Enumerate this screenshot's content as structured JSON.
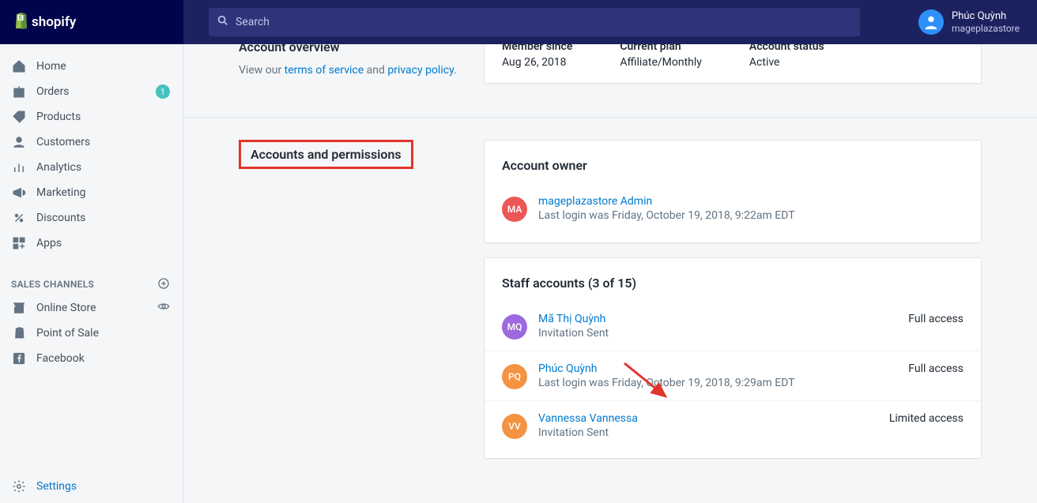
{
  "header": {
    "search_placeholder": "Search",
    "user_name": "Phúc Quỳnh",
    "user_sub": "mageplazastore"
  },
  "sidebar": {
    "items": [
      {
        "label": "Home",
        "icon": "home"
      },
      {
        "label": "Orders",
        "icon": "orders",
        "badge": "1"
      },
      {
        "label": "Products",
        "icon": "products"
      },
      {
        "label": "Customers",
        "icon": "customers"
      },
      {
        "label": "Analytics",
        "icon": "analytics"
      },
      {
        "label": "Marketing",
        "icon": "marketing"
      },
      {
        "label": "Discounts",
        "icon": "discounts"
      },
      {
        "label": "Apps",
        "icon": "apps"
      }
    ],
    "section_title": "SALES CHANNELS",
    "channels": [
      {
        "label": "Online Store",
        "icon": "store",
        "action": "eye"
      },
      {
        "label": "Point of Sale",
        "icon": "pos"
      },
      {
        "label": "Facebook",
        "icon": "facebook"
      }
    ],
    "settings_label": "Settings"
  },
  "overview": {
    "title": "Account overview",
    "pre_text": "View our ",
    "tos": "terms of service",
    "and": " and ",
    "privacy": "privacy policy",
    "dot": ".",
    "member_since_lbl": "Member since",
    "member_since_val": "Aug 26, 2018",
    "plan_lbl": "Current plan",
    "plan_val": "Affiliate/Monthly",
    "status_lbl": "Account status",
    "status_val": "Active"
  },
  "accounts_section": {
    "title": "Accounts and permissions"
  },
  "owner": {
    "title": "Account owner",
    "initials": "MA",
    "name": "mageplazastore Admin",
    "sub": "Last login was Friday, October 19, 2018, 9:22am EDT"
  },
  "staff": {
    "title": "Staff accounts (3 of 15)",
    "rows": [
      {
        "initials": "MQ",
        "av": "purple",
        "name": "Mã Thị Quỳnh",
        "sub": "Invitation Sent",
        "access": "Full access"
      },
      {
        "initials": "PQ",
        "av": "orange",
        "name": "Phúc Quỳnh",
        "sub": "Last login was Friday, October 19, 2018, 9:29am EDT",
        "access": "Full access"
      },
      {
        "initials": "VV",
        "av": "orange",
        "name": "Vannessa Vannessa",
        "sub": "Invitation Sent",
        "access": "Limited access"
      }
    ]
  }
}
